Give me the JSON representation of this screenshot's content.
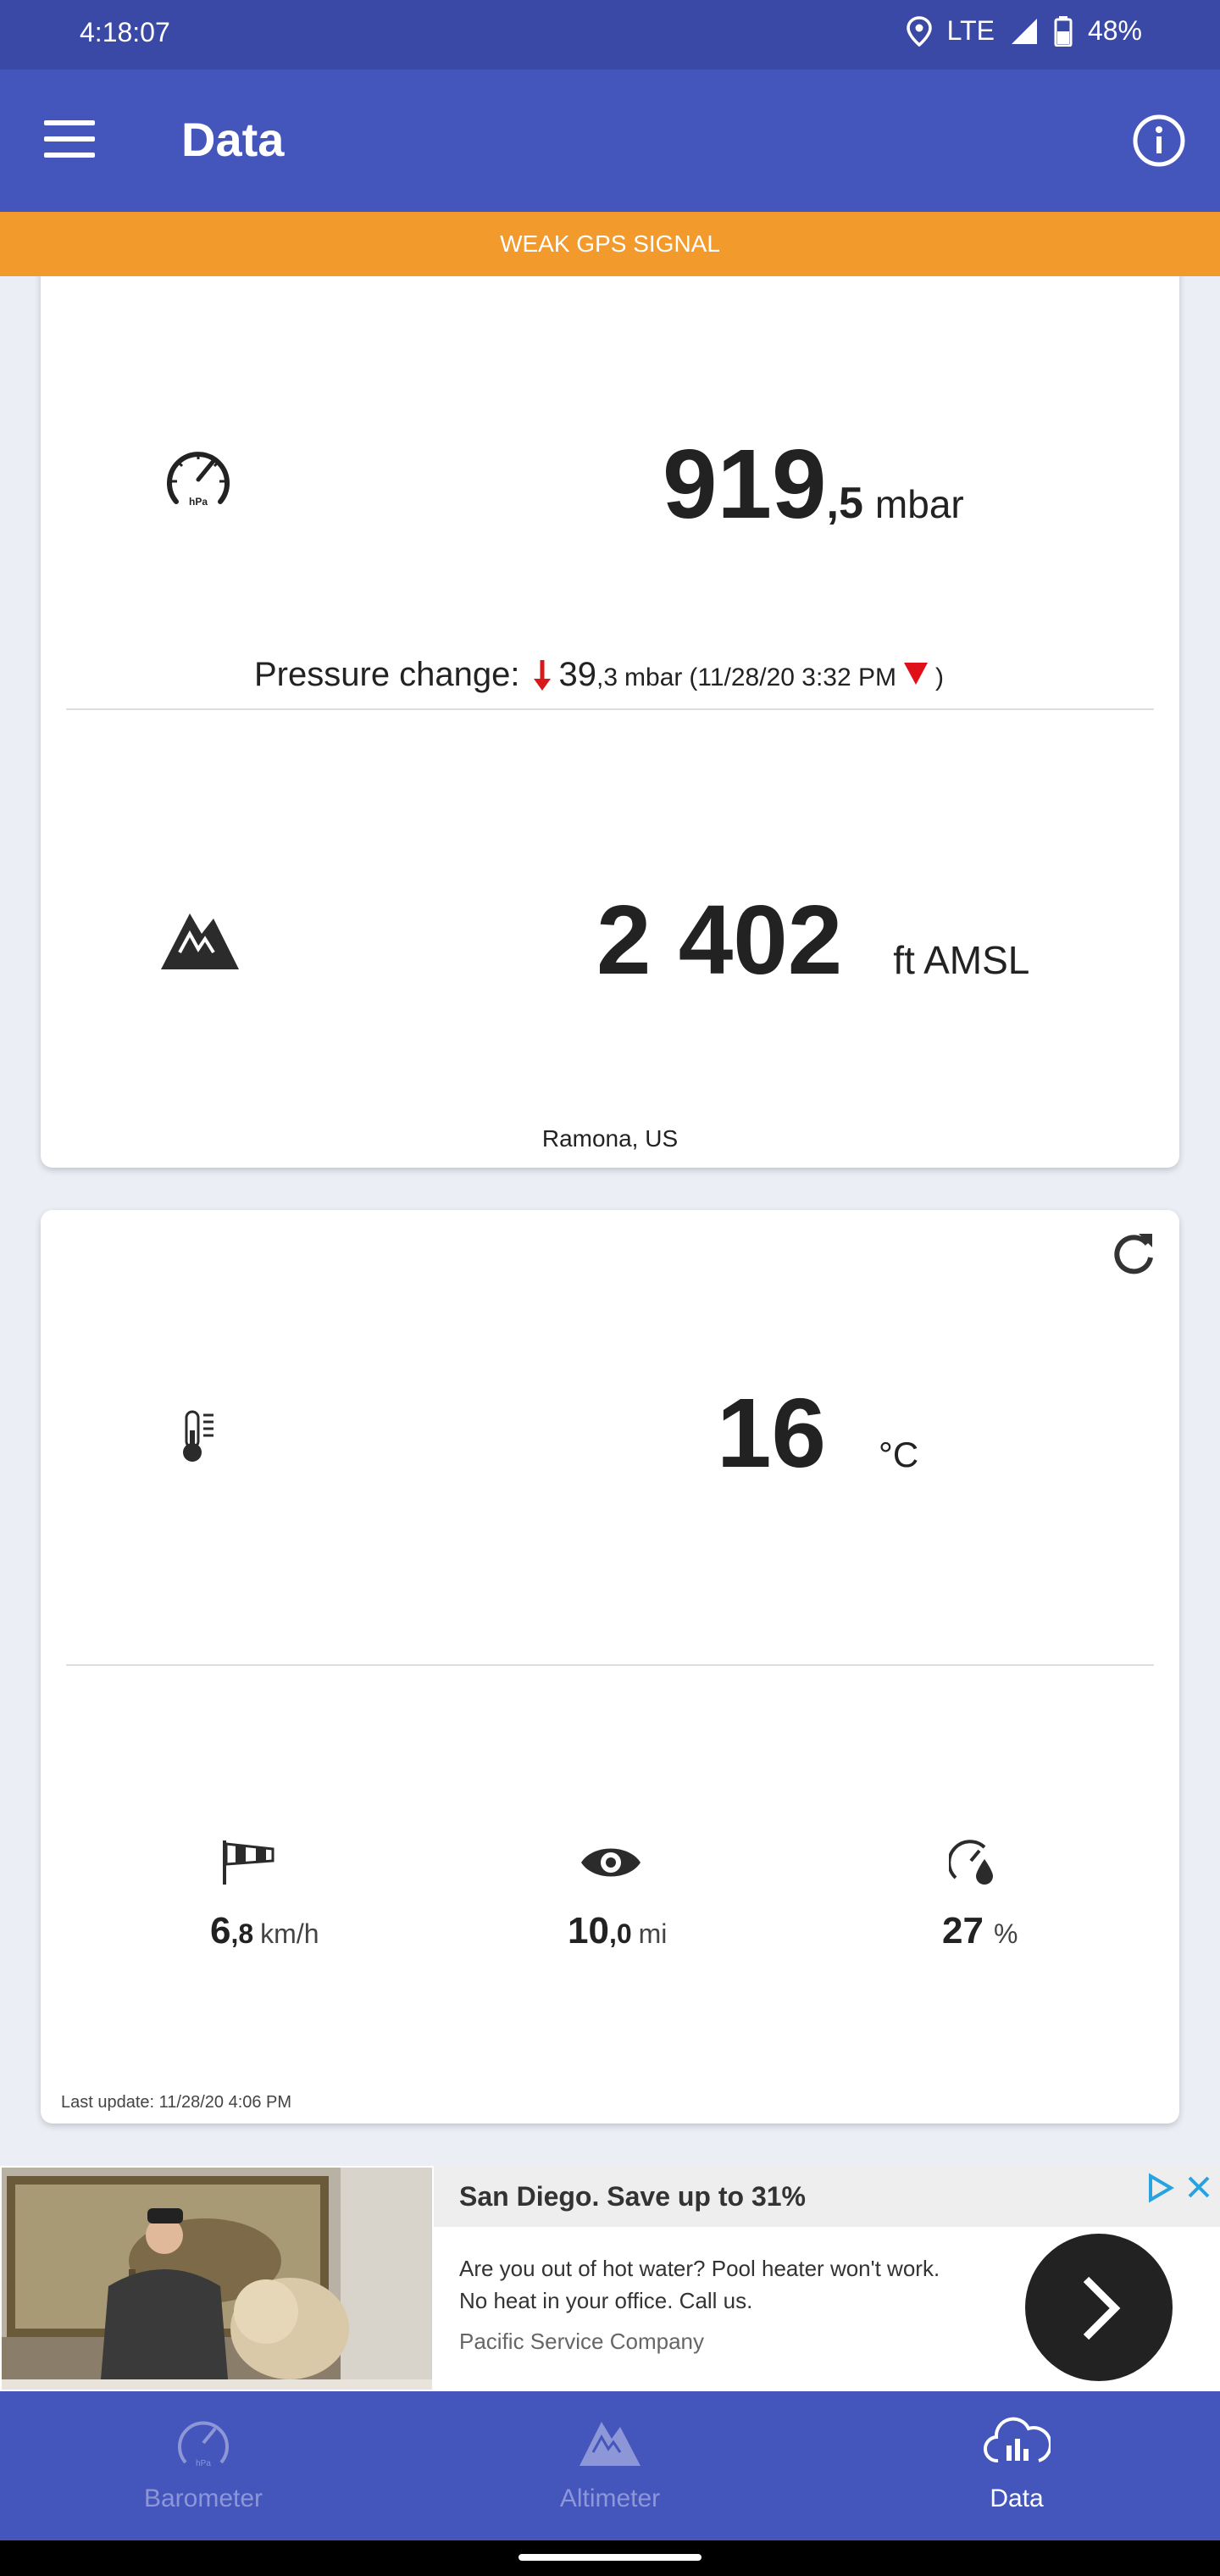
{
  "status_bar": {
    "time": "4:18:07",
    "network": "LTE",
    "battery": "48%"
  },
  "app_bar": {
    "title": "Data"
  },
  "gps_banner": "WEAK GPS SIGNAL",
  "pressure": {
    "int": "919",
    "dec": ",5",
    "unit": "mbar",
    "change_label": "Pressure change:",
    "change_int": "39",
    "change_dec": ",3",
    "change_unit": "mbar",
    "change_time": "(11/28/20 3:32 PM",
    "change_close": ")",
    "arrow_color": "#d7191c"
  },
  "altitude": {
    "value": "2 402",
    "unit": "ft AMSL",
    "location": "Ramona, US"
  },
  "weather": {
    "temperature": "16",
    "temp_unit": "°C",
    "wind_int": "6",
    "wind_dec": ",8",
    "wind_unit": "km/h",
    "visibility_int": "10",
    "visibility_dec": ",0",
    "visibility_unit": "mi",
    "humidity": "27",
    "humidity_unit": "%",
    "last_update": "Last update: 11/28/20 4:06 PM"
  },
  "ad": {
    "headline": "San Diego. Save up to 31%",
    "body": "Are you out of hot water? Pool heater won't work. No heat in your office. Call us.",
    "advertiser": "Pacific Service Company"
  },
  "bottom_nav": [
    {
      "label": "Barometer",
      "icon": "barometer-icon",
      "active": false
    },
    {
      "label": "Altimeter",
      "icon": "mountain-icon",
      "active": false
    },
    {
      "label": "Data",
      "icon": "cloud-data-icon",
      "active": true
    }
  ],
  "colors": {
    "primary": "#4455bb",
    "status_bar": "#3a49a6",
    "warning": "#f39a2c",
    "inactive_nav": "#8d97d8"
  }
}
